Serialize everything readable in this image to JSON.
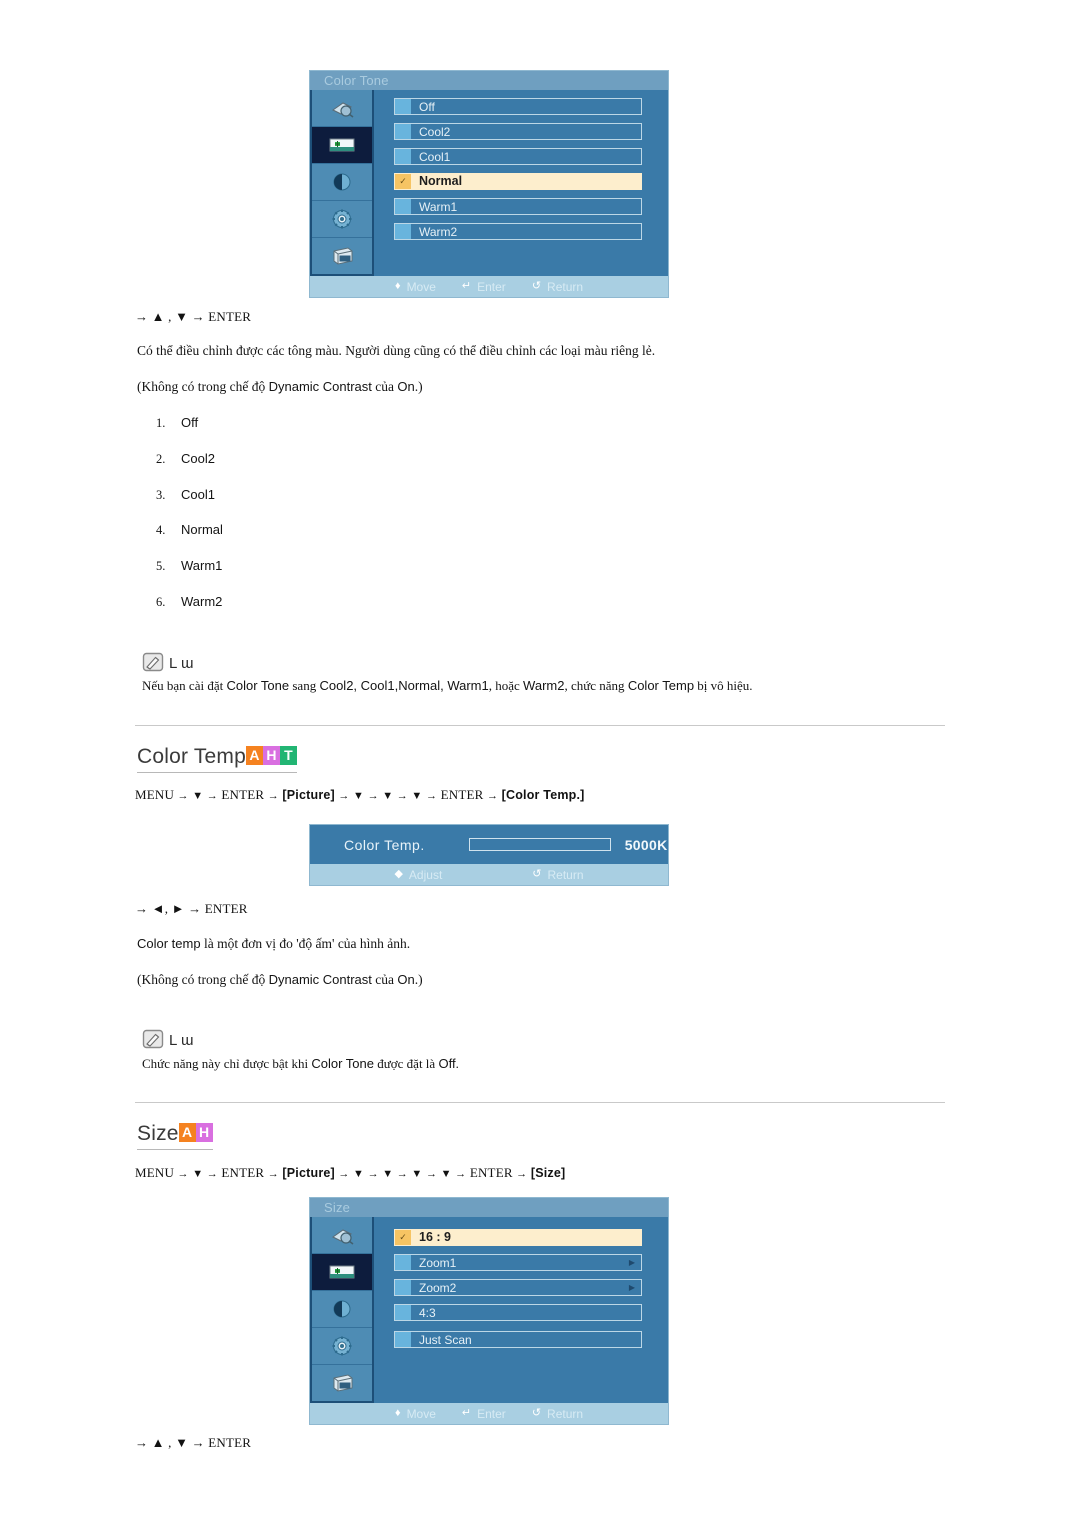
{
  "document": {
    "language": "vi",
    "sections": [
      {
        "id": "color-tone",
        "osd": {
          "title": "Color Tone",
          "rows": [
            {
              "label": "Off",
              "selected": false,
              "submenu": false
            },
            {
              "label": "Cool2",
              "selected": false,
              "submenu": false
            },
            {
              "label": "Cool1",
              "selected": false,
              "submenu": false
            },
            {
              "label": "Normal",
              "selected": true,
              "submenu": false
            },
            {
              "label": "Warm1",
              "selected": false,
              "submenu": false
            },
            {
              "label": "Warm2",
              "selected": false,
              "submenu": false
            }
          ],
          "footer": [
            {
              "glyph": "♦",
              "label": "Move"
            },
            {
              "glyph": "↵",
              "label": "Enter"
            },
            {
              "glyph": "↺",
              "label": "Return"
            }
          ],
          "sidebar_icons": [
            "input-source-icon",
            "picture-icon",
            "sound-icon",
            "setup-gear-icon",
            "multi-control-icon"
          ],
          "active_sidebar_index": 1
        },
        "keys_line": "→ ▲ , ▼ → ENTER",
        "paragraph": "Có thể điều chỉnh được các tông màu. Người dùng cũng có thể điều chỉnh các loại màu riêng lẻ.",
        "condition_prefix": "(Không có trong chế độ ",
        "condition_term": "Dynamic Contrast",
        "condition_mid": " của ",
        "condition_value": "On",
        "condition_suffix": ".)",
        "options": [
          {
            "num": "1.",
            "label": "Off"
          },
          {
            "num": "2.",
            "label": "Cool2"
          },
          {
            "num": "3.",
            "label": "Cool1"
          },
          {
            "num": "4.",
            "label": "Normal"
          },
          {
            "num": "5.",
            "label": "Warm1"
          },
          {
            "num": "6.",
            "label": "Warm2"
          }
        ],
        "note": {
          "label": "L ɯ",
          "text_parts": [
            {
              "t": "Nếu bạn cài đặt ",
              "s": false
            },
            {
              "t": "Color Tone",
              "s": true
            },
            {
              "t": " sang ",
              "s": false
            },
            {
              "t": "Cool2, Cool1,Normal, Warm1",
              "s": true
            },
            {
              "t": ", hoặc ",
              "s": false
            },
            {
              "t": "Warm2",
              "s": true
            },
            {
              "t": ", chức năng ",
              "s": false
            },
            {
              "t": "Color Temp",
              "s": true
            },
            {
              "t": " bị vô hiệu.",
              "s": false
            }
          ]
        }
      },
      {
        "id": "color-temp",
        "heading": "Color Temp",
        "badges": [
          {
            "letter": "A",
            "color": "#F58220"
          },
          {
            "letter": "H",
            "color": "#D96FE0"
          },
          {
            "letter": "T",
            "color": "#22B573"
          }
        ],
        "nav_path": {
          "start": "MENU",
          "steps": [
            "▼",
            "ENTER"
          ],
          "bracket1": "[Picture]",
          "arrows": [
            "▼",
            "▼",
            "▼"
          ],
          "enter": "ENTER",
          "bracket2": "[Color Temp.]"
        },
        "osd": {
          "label": "Color  Temp.",
          "value": "5000K",
          "footer": [
            {
              "glyph": "◆",
              "label": "Adjust"
            },
            {
              "glyph": "↺",
              "label": "Return"
            }
          ]
        },
        "keys_line": "→ ◄, ► → ENTER",
        "paragraph_parts": [
          {
            "t": "Color temp",
            "s": true
          },
          {
            "t": " là một đơn vị đo 'độ ấm' của hình ảnh.",
            "s": false
          }
        ],
        "condition_prefix": "(Không có trong chế độ ",
        "condition_term": "Dynamic Contrast",
        "condition_mid": " của ",
        "condition_value": "On",
        "condition_suffix": ".)",
        "note": {
          "label": "L ɯ",
          "text_parts": [
            {
              "t": "Chức năng này chỉ được bật khi ",
              "s": false
            },
            {
              "t": "Color Tone",
              "s": true
            },
            {
              "t": " được đặt là ",
              "s": false
            },
            {
              "t": "Off",
              "s": true
            },
            {
              "t": ".",
              "s": false
            }
          ]
        }
      },
      {
        "id": "size",
        "heading": "Size",
        "badges": [
          {
            "letter": "A",
            "color": "#F58220"
          },
          {
            "letter": "H",
            "color": "#D96FE0"
          }
        ],
        "nav_path": {
          "start": "MENU",
          "steps": [
            "▼",
            "ENTER"
          ],
          "bracket1": "[Picture]",
          "arrows": [
            "▼",
            "▼",
            "▼",
            "▼"
          ],
          "enter": "ENTER",
          "bracket2": "[Size]"
        },
        "osd": {
          "title": "Size",
          "rows": [
            {
              "label": "16 : 9",
              "selected": true,
              "submenu": false
            },
            {
              "label": "Zoom1",
              "selected": false,
              "submenu": true
            },
            {
              "label": "Zoom2",
              "selected": false,
              "submenu": true
            },
            {
              "label": "4:3",
              "selected": false,
              "submenu": false
            },
            {
              "label": "Just  Scan",
              "selected": false,
              "submenu": false
            }
          ],
          "footer": [
            {
              "glyph": "♦",
              "label": "Move"
            },
            {
              "glyph": "↵",
              "label": "Enter"
            },
            {
              "glyph": "↺",
              "label": "Return"
            }
          ],
          "sidebar_icons": [
            "input-source-icon",
            "picture-icon",
            "sound-icon",
            "setup-gear-icon",
            "multi-control-icon"
          ],
          "active_sidebar_index": 1
        },
        "keys_line": "→ ▲ , ▼ → ENTER"
      }
    ]
  },
  "colors": {
    "osd_bg": "#3a7aa8",
    "osd_title_bar": "#6f9fc0",
    "osd_footer": "#a9cfe2",
    "osd_chip": "#68b4dd",
    "osd_selected_bg": "#fdeecd",
    "osd_selected_chip": "#f6c463",
    "sidebar_active": "#0d1c3d",
    "rule": "#c9c9c9"
  }
}
